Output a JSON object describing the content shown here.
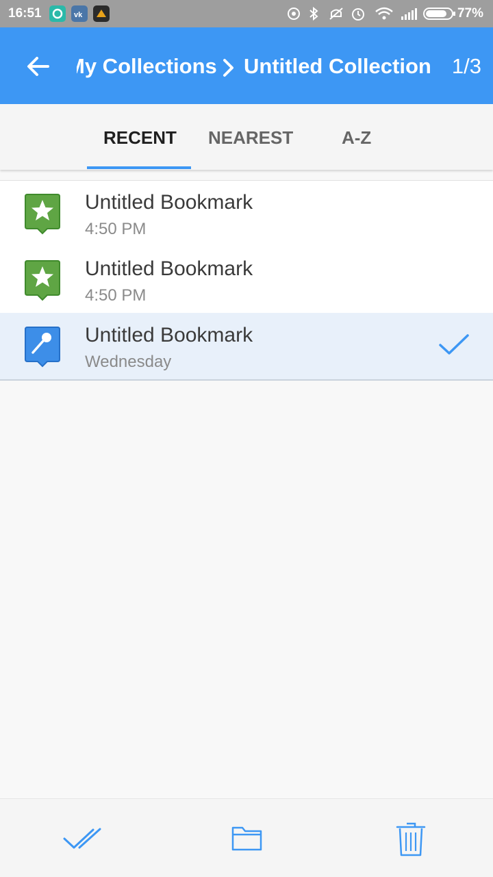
{
  "status_bar": {
    "time": "16:51",
    "battery": "77%",
    "apps": [
      "app-icon-teal",
      "vk-icon",
      "app-icon-dark"
    ]
  },
  "app_bar": {
    "breadcrumb_parent": "My Collections",
    "breadcrumb_current": "Untitled Collection",
    "page_counter": "1/3",
    "color": "#3d97f4"
  },
  "tabs": {
    "items": [
      "RECENT",
      "NEAREST",
      "A-Z"
    ],
    "active": "RECENT"
  },
  "bookmarks": [
    {
      "title": "Untitled Bookmark",
      "subtitle": "4:50 PM",
      "icon": "star-pin-icon",
      "color": "#5fa544",
      "selected": false
    },
    {
      "title": "Untitled Bookmark",
      "subtitle": "4:50 PM",
      "icon": "star-pin-icon",
      "color": "#5fa544",
      "selected": false
    },
    {
      "title": "Untitled Bookmark",
      "subtitle": "Wednesday",
      "icon": "microphone-pin-icon",
      "color": "#3d8ee8",
      "selected": true
    }
  ],
  "toolbar": {
    "select_all": "double-check-icon",
    "move": "folder-icon",
    "delete": "trash-icon"
  }
}
